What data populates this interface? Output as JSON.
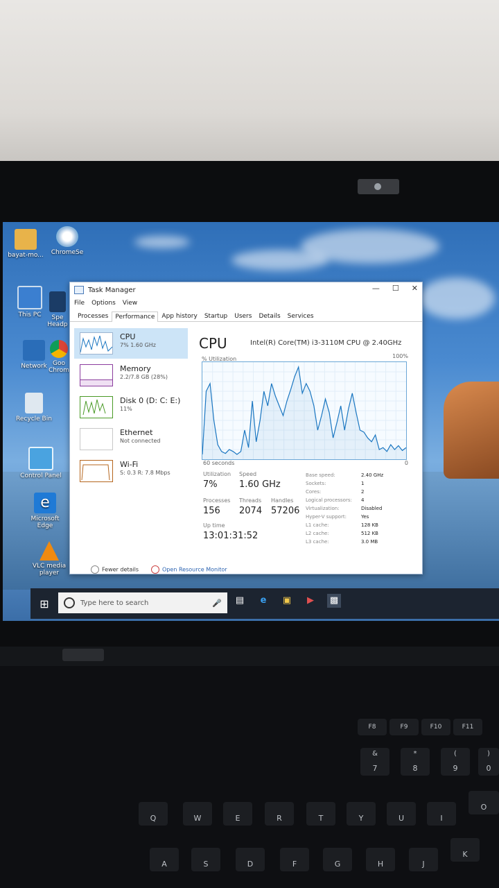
{
  "desktop": {
    "icons": [
      {
        "label": "bayat-mo...",
        "name": "folder-user-icon"
      },
      {
        "label": "ChromeSe",
        "name": "setup-disc-icon"
      },
      {
        "label": "This PC",
        "name": "computer-icon"
      },
      {
        "label": "Spe Headp",
        "name": "app-icon"
      },
      {
        "label": "Network",
        "name": "network-icon"
      },
      {
        "label": "Goo Chrom",
        "name": "chrome-icon"
      },
      {
        "label": "Recycle Bin",
        "name": "recycle-bin-icon"
      },
      {
        "label": "Control Panel",
        "name": "control-panel-icon"
      },
      {
        "label": "Microsoft Edge",
        "name": "edge-icon"
      },
      {
        "label": "VLC media player",
        "name": "vlc-icon"
      }
    ]
  },
  "taskbar": {
    "search_placeholder": "Type here to search"
  },
  "task_manager": {
    "title": "Task Manager",
    "menu": [
      "File",
      "Options",
      "View"
    ],
    "tabs": [
      "Processes",
      "Performance",
      "App history",
      "Startup",
      "Users",
      "Details",
      "Services"
    ],
    "active_tab": "Performance",
    "left_items": [
      {
        "name": "CPU",
        "sub": "7% 1.60 GHz",
        "selected": true,
        "color": "#1a76c1"
      },
      {
        "name": "Memory",
        "sub": "2.2/7.8 GB (28%)",
        "selected": false,
        "color": "#8b3d9e"
      },
      {
        "name": "Disk 0 (D: C: E:)",
        "sub": "11%",
        "selected": false,
        "color": "#4a9a26"
      },
      {
        "name": "Ethernet",
        "sub": "Not connected",
        "selected": false,
        "color": "#a0a0a0"
      },
      {
        "name": "Wi-Fi",
        "sub": "S: 0.3 R: 7.8 Mbps",
        "selected": false,
        "color": "#b5651d"
      }
    ],
    "cpu": {
      "heading": "CPU",
      "model": "Intel(R) Core(TM) i3-3110M CPU @ 2.40GHz",
      "util_label": "% Utilization",
      "max_label": "100%",
      "time_label": "60 seconds",
      "min_label": "0",
      "utilization_label": "Utilization",
      "utilization": "7%",
      "speed_label": "Speed",
      "speed": "1.60 GHz",
      "processes_label": "Processes",
      "processes": "156",
      "threads_label": "Threads",
      "threads": "2074",
      "handles_label": "Handles",
      "handles": "57206",
      "uptime_label": "Up time",
      "uptime": "13:01:31:52",
      "specs": [
        {
          "k": "Base speed:",
          "v": "2.40 GHz"
        },
        {
          "k": "Sockets:",
          "v": "1"
        },
        {
          "k": "Cores:",
          "v": "2"
        },
        {
          "k": "Logical processors:",
          "v": "4"
        },
        {
          "k": "Virtualization:",
          "v": "Disabled"
        },
        {
          "k": "Hyper-V support:",
          "v": "Yes"
        },
        {
          "k": "L1 cache:",
          "v": "128 KB"
        },
        {
          "k": "L2 cache:",
          "v": "512 KB"
        },
        {
          "k": "L3 cache:",
          "v": "3.0 MB"
        }
      ],
      "history": [
        5,
        70,
        78,
        40,
        15,
        8,
        6,
        10,
        8,
        5,
        8,
        30,
        12,
        60,
        18,
        40,
        70,
        55,
        78,
        65,
        55,
        45,
        60,
        72,
        85,
        95,
        68,
        78,
        70,
        55,
        30,
        45,
        62,
        48,
        22,
        38,
        55,
        30,
        52,
        68,
        48,
        30,
        28,
        22,
        18,
        25,
        10,
        12,
        8,
        15,
        10,
        14,
        9,
        12
      ]
    },
    "footer": {
      "fewer": "Fewer details",
      "monitor": "Open Resource Monitor"
    }
  },
  "keyboard": {
    "fkeys": [
      "F8",
      "F9",
      "F10",
      "F11"
    ],
    "numrow": [
      {
        "u": "&",
        "l": "7"
      },
      {
        "u": "*",
        "l": "8"
      },
      {
        "u": "(",
        "l": "9"
      },
      {
        "u": ")",
        "l": "0"
      }
    ],
    "letters": [
      "Q",
      "W",
      "E",
      "R",
      "T",
      "Y",
      "U",
      "I",
      "O"
    ],
    "bottom": [
      "A",
      "S",
      "D",
      "F",
      "G",
      "H",
      "J",
      "K"
    ]
  }
}
